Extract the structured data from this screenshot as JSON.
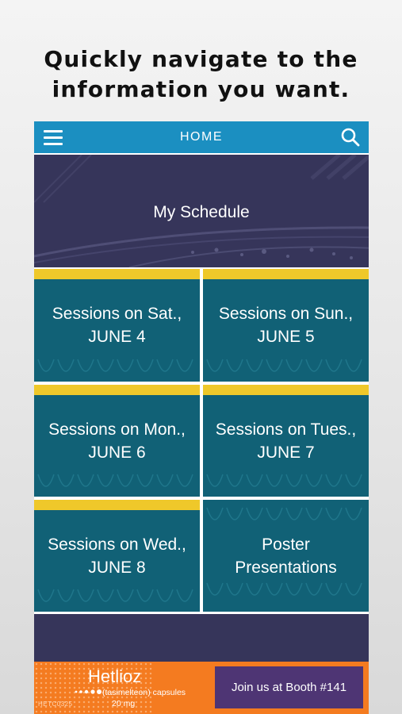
{
  "promo": {
    "headline_line1": "Quickly navigate to the",
    "headline_line2": "information you want."
  },
  "topbar": {
    "menu_icon": "hamburger-menu-icon",
    "title": "HOME",
    "search_icon": "search-icon",
    "color": "#1b8fc1"
  },
  "schedule": {
    "label": "My Schedule",
    "color": "#36355a"
  },
  "tiles": [
    {
      "line1": "Sessions on Sat.,",
      "line2": "JUNE 4"
    },
    {
      "line1": "Sessions on Sun.,",
      "line2": "JUNE 5"
    },
    {
      "line1": "Sessions on Mon.,",
      "line2": "JUNE 6"
    },
    {
      "line1": "Sessions on Tues.,",
      "line2": "JUNE 7"
    },
    {
      "line1": "Sessions on Wed.,",
      "line2": "JUNE 8"
    },
    {
      "line1": "Poster",
      "line2": "Presentations"
    }
  ],
  "colors": {
    "tile": "#116176",
    "tile_accent": "#efc82a",
    "footer": "#f47b20",
    "booth": "#4e3574"
  },
  "footer": {
    "brand": "Hetlioz",
    "brand_sub": "(tasimelteon) capsules",
    "dose": "20 mg",
    "code": "HETC0325",
    "booth_label": "Join us at Booth #141"
  }
}
